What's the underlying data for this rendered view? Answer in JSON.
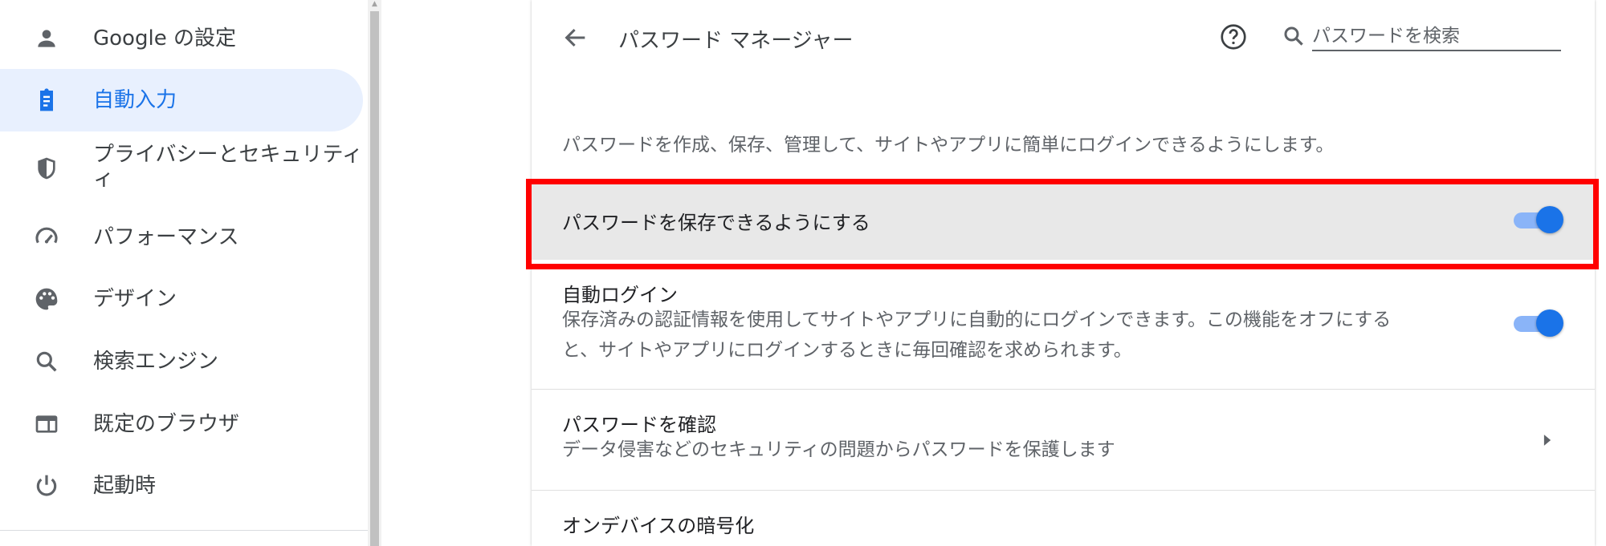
{
  "sidebar": {
    "items": [
      {
        "label": "Google の設定",
        "icon": "person-icon"
      },
      {
        "label": "自動入力",
        "icon": "clipboard-icon",
        "active": true
      },
      {
        "label": "プライバシーとセキュリティ",
        "label_line2": "ィ",
        "icon": "shield-icon"
      },
      {
        "label": "パフォーマンス",
        "icon": "speedometer-icon"
      },
      {
        "label": "デザイン",
        "icon": "palette-icon"
      },
      {
        "label": "検索エンジン",
        "icon": "search-icon"
      },
      {
        "label": "既定のブラウザ",
        "icon": "browser-window-icon"
      },
      {
        "label": "起動時",
        "icon": "power-icon"
      }
    ]
  },
  "header": {
    "title": "パスワード マネージャー",
    "search_placeholder": "パスワードを検索"
  },
  "main": {
    "description": "パスワードを作成、保存、管理して、サイトやアプリに簡単にログインできるようにします。",
    "rows": [
      {
        "title": "パスワードを保存できるようにする",
        "toggle": true
      },
      {
        "title": "自動ログイン",
        "subtitle_line1": "保存済みの認証情報を使用してサイトやアプリに自動的にログインできます。この機能をオフにする",
        "subtitle_line2": "と、サイトやアプリにログインするときに毎回確認を求められます。",
        "toggle": true
      },
      {
        "title": "パスワードを確認",
        "subtitle": "データ侵害などのセキュリティの問題からパスワードを保護します"
      },
      {
        "title": "オンデバイスの暗号化"
      }
    ]
  },
  "colors": {
    "accent": "#1a73e8",
    "active_bg": "#e8f0fe",
    "highlight_box": "#ff0000",
    "toggle_track": "#8ab4f8"
  }
}
